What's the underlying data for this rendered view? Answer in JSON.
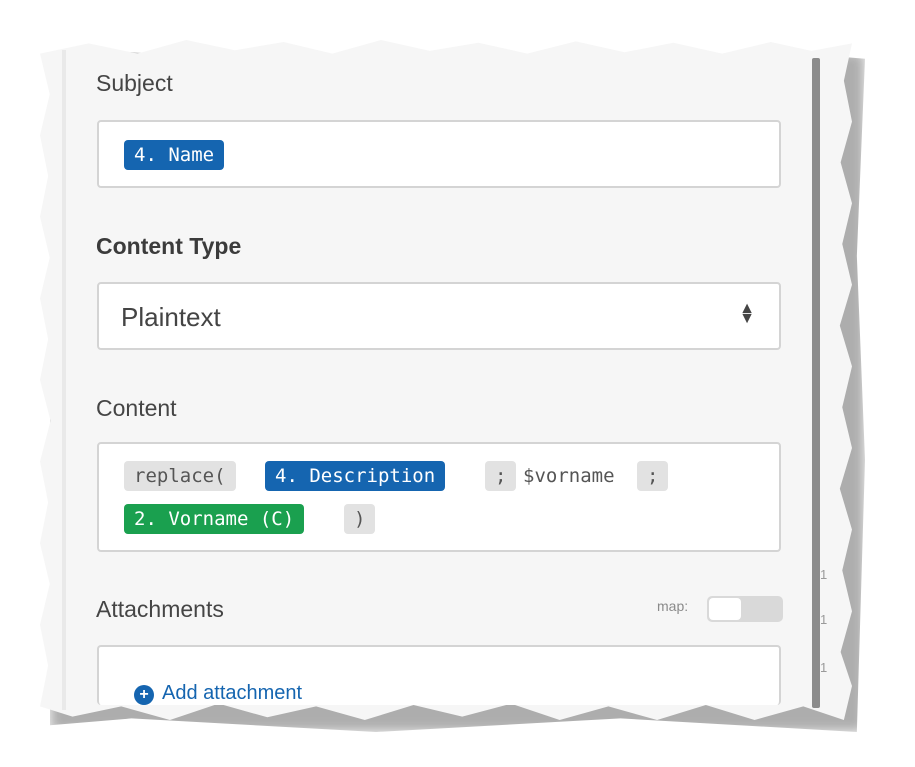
{
  "subject": {
    "label": "Subject",
    "chip": "4. Name"
  },
  "content_type": {
    "label": "Content Type",
    "value": "Plaintext"
  },
  "content": {
    "label": "Content",
    "tokens": {
      "fn": "replace(",
      "description": "4. Description",
      "sep1": ";",
      "var": "$vorname",
      "sep2": ";",
      "vorname": "2. Vorname (C)",
      "close": ")"
    }
  },
  "attachments": {
    "label": "Attachments",
    "map_label": "map:",
    "add_label": "Add attachment"
  },
  "ghost_digits": [
    "1",
    "1",
    "1"
  ],
  "colors": {
    "chip_blue": "#1565b0",
    "chip_green": "#1aa04f",
    "chip_gray": "#e2e2e2"
  }
}
